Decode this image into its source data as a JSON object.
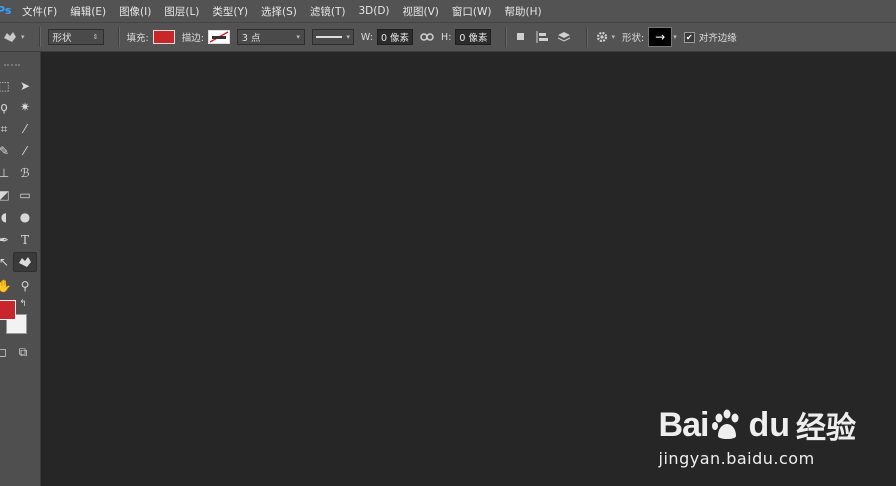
{
  "app": {
    "logo_text": "Ps"
  },
  "menu": {
    "items": [
      "文件(F)",
      "编辑(E)",
      "图像(I)",
      "图层(L)",
      "类型(Y)",
      "选择(S)",
      "滤镜(T)",
      "3D(D)",
      "视图(V)",
      "窗口(W)",
      "帮助(H)"
    ]
  },
  "options": {
    "mode_value": "形状",
    "fill_label": "填充:",
    "fill_color": "#c8262b",
    "stroke_label": "描边:",
    "stroke_width": "3 点",
    "width_label": "W:",
    "width_value": "0 像素",
    "height_label": "H:",
    "height_value": "0 像素",
    "shape_label": "形状:",
    "shape_glyph": "→",
    "align_edges_label": "对齐边缘",
    "align_edges_checked": true
  },
  "tools": {
    "foreground_color": "#c8262b",
    "background_color": "#f2f2f2"
  },
  "watermark": {
    "brand_part1": "Bai",
    "brand_part2": "du",
    "brand_cn": "经验",
    "url": "jingyan.baidu.com"
  }
}
